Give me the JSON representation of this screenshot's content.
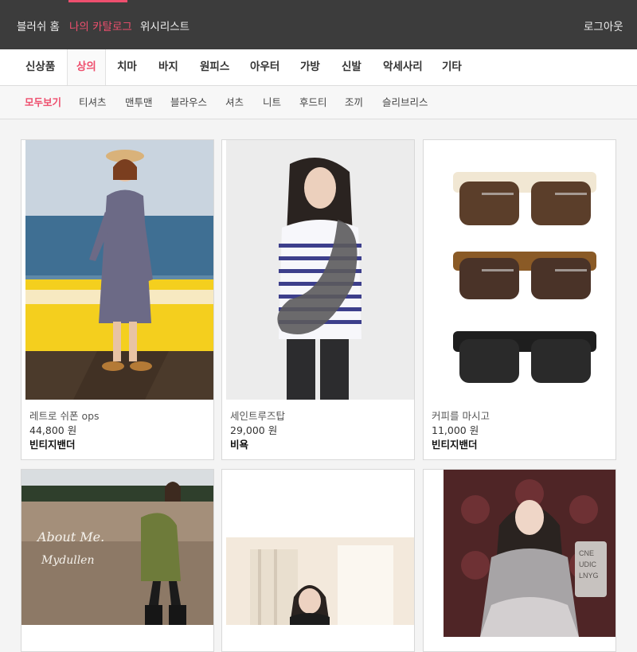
{
  "top_nav": {
    "items": [
      {
        "label": "블러쉬 홈",
        "active": false
      },
      {
        "label": "나의 카탈로그",
        "active": true
      },
      {
        "label": "위시리스트",
        "active": false
      }
    ],
    "logout_label": "로그아웃"
  },
  "categories": [
    {
      "label": "신상품",
      "active": false
    },
    {
      "label": "상의",
      "active": true
    },
    {
      "label": "치마",
      "active": false
    },
    {
      "label": "바지",
      "active": false
    },
    {
      "label": "원피스",
      "active": false
    },
    {
      "label": "아우터",
      "active": false
    },
    {
      "label": "가방",
      "active": false
    },
    {
      "label": "신발",
      "active": false
    },
    {
      "label": "악세사리",
      "active": false
    },
    {
      "label": "기타",
      "active": false
    }
  ],
  "subcategories": [
    {
      "label": "모두보기",
      "active": true
    },
    {
      "label": "티셔츠",
      "active": false
    },
    {
      "label": "맨투맨",
      "active": false
    },
    {
      "label": "블라우스",
      "active": false
    },
    {
      "label": "셔츠",
      "active": false
    },
    {
      "label": "니트",
      "active": false
    },
    {
      "label": "후드티",
      "active": false
    },
    {
      "label": "조끼",
      "active": false
    },
    {
      "label": "슬리브리스",
      "active": false
    }
  ],
  "products": [
    {
      "name": "레트로 쉬폰 ops",
      "price": "44,800 원",
      "brand": "빈티지밴더",
      "image": "woman-by-seawall-photo"
    },
    {
      "name": "세인트루즈탑",
      "price": "29,000 원",
      "brand": "비욕",
      "image": "striped-top-model-photo"
    },
    {
      "name": "커피를 마시고",
      "price": "11,000 원",
      "brand": "빈티지밴더",
      "image": "sunglasses-photo"
    },
    {
      "name": "",
      "price": "",
      "brand": "",
      "image": "khaki-coat-beach-photo",
      "overlay_text": [
        "About Me.",
        "Mydullen"
      ]
    },
    {
      "name": "",
      "price": "",
      "brand": "",
      "image": "woman-by-window-photo"
    },
    {
      "name": "",
      "price": "",
      "brand": "",
      "image": "knit-sweater-sofa-photo",
      "overlay_text": [
        "CNE",
        "UDIC",
        "LNYG"
      ]
    }
  ],
  "colors": {
    "accent": "#ee4f6e",
    "top_bar_bg": "#3c3c3c",
    "page_bg": "#f4f4f4"
  }
}
